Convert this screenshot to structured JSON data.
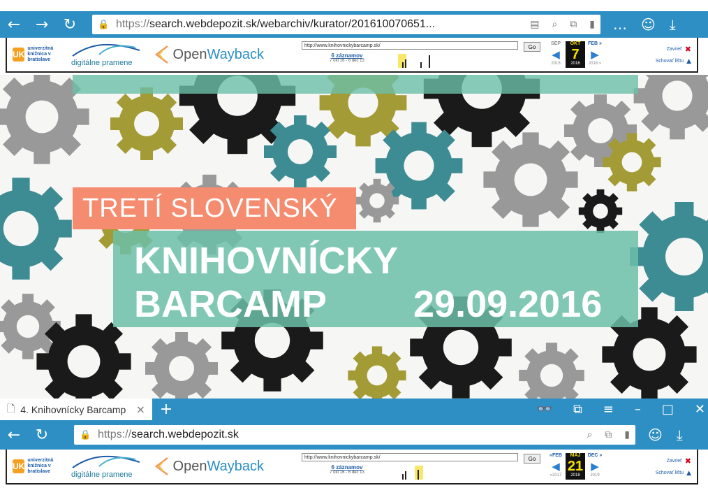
{
  "top_browser": {
    "url_proto": "https://",
    "url_rest": "search.webdepozit.sk/webarchiv/kurator/201610070651...",
    "nav": {
      "back": "←",
      "forward": "→",
      "refresh": "↻"
    },
    "more": "…"
  },
  "wayback_top": {
    "ukb_text": "univerzitná knižnica v bratislave",
    "dp_text": "digitálne pramene",
    "ow_open": "Open",
    "ow_wayback": "Wayback",
    "url_value": "http://www.knihovnickybarcamp.sk/",
    "go_label": "Go",
    "captures_link": "6 záznamov",
    "captures_range": "7 okt 16 - 6 dec 13",
    "prev_month": "SEP",
    "cur_month": "OKT",
    "next_month": "FEB »",
    "cur_day": "7",
    "prev_year": "2015",
    "cur_year": "2016",
    "next_year": "2018 »",
    "close_label": "Zavrieť",
    "hide_label": "Schovať lištu"
  },
  "hero": {
    "line1": "TRETÍ SLOVENSKÝ",
    "line2": "KNIHOVNÍCKY",
    "line3": "BARCAMP",
    "date": "29.09.2016"
  },
  "tabbar": {
    "tab_title": "4. Knihovnícky Barcamp",
    "tab_close": "×",
    "new_tab": "+"
  },
  "bottom_browser": {
    "url_proto": "https://",
    "url_rest": "search.webdepozit.sk"
  },
  "wayback_bottom": {
    "url_value": "http://www.knihovnickybarcamp.sk/",
    "go_label": "Go",
    "captures_link": "6 záznamov",
    "captures_range": "7 okt 16 - 6 dec 13",
    "prev_month": "«FEB",
    "cur_month": "MÁJ",
    "next_month": "DEC »",
    "cur_day": "21",
    "prev_year": "«2017",
    "cur_year": "2018",
    "next_year": "2019",
    "close_label": "Zavrieť",
    "hide_label": "Schovať lištu"
  },
  "colors": {
    "browser_blue": "#2e8fc4",
    "teal": "#3d8b93",
    "olive": "#a39b35",
    "coral": "#f58b6f",
    "mint": "#6cbfa8"
  }
}
